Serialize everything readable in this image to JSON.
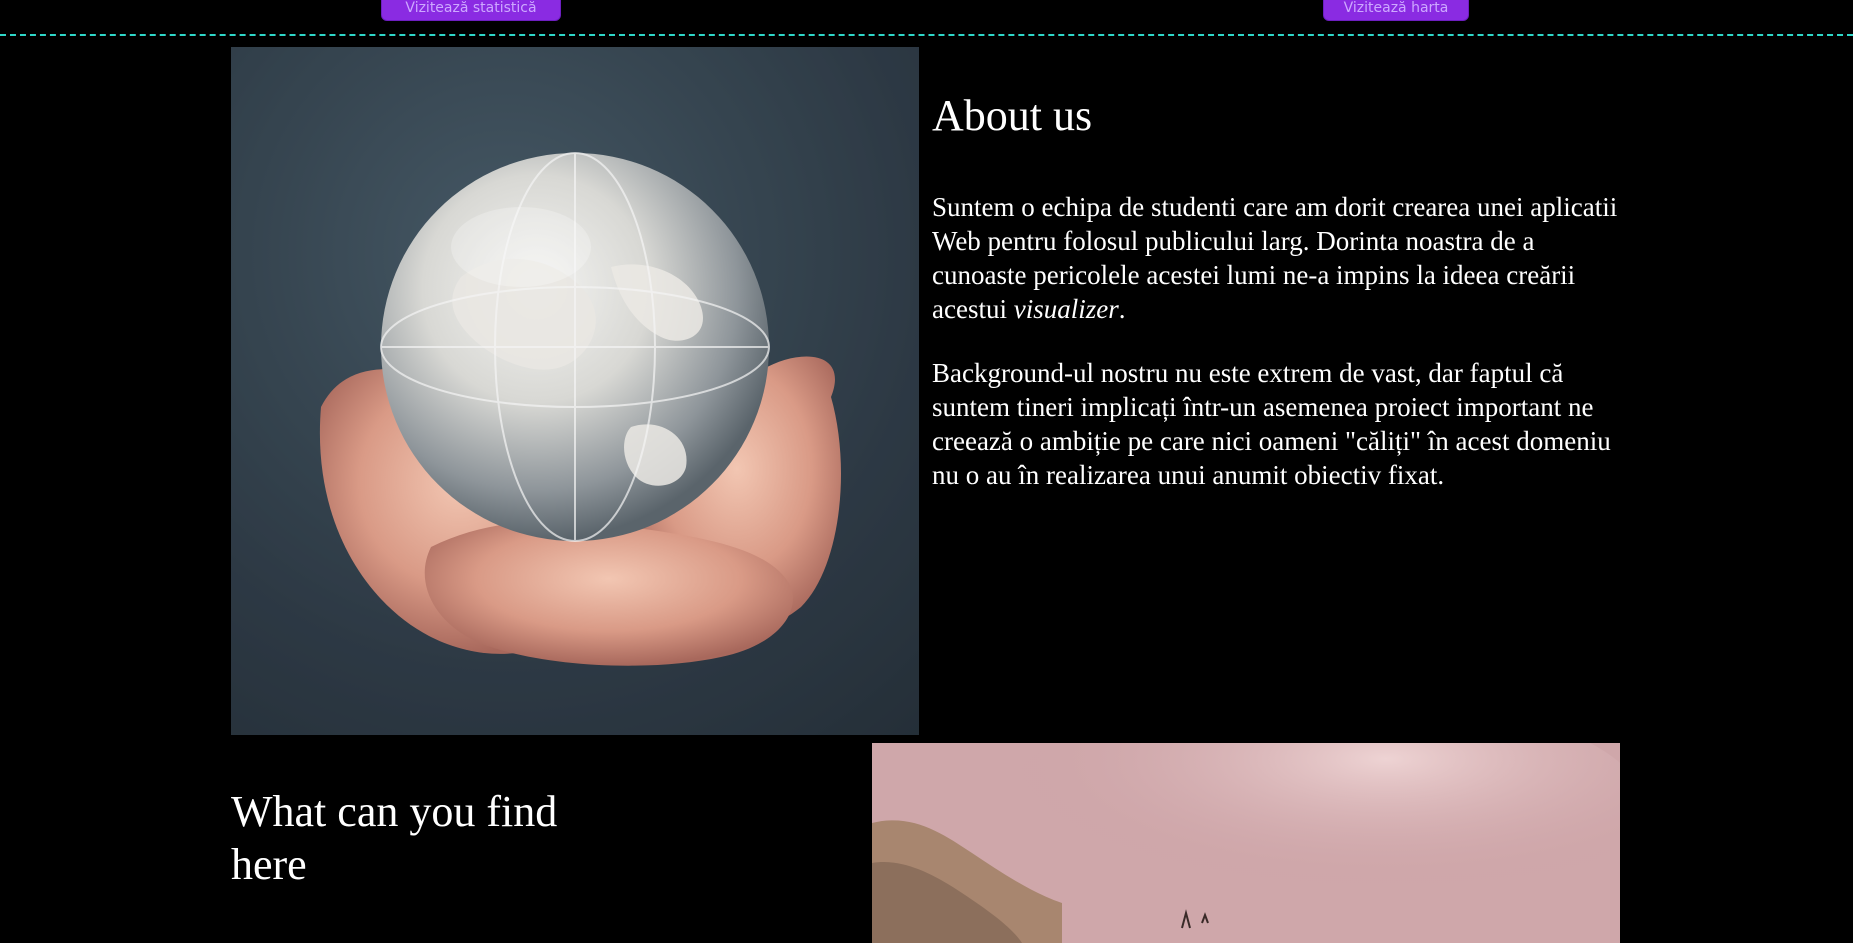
{
  "header": {
    "statistics_button": "Vizitează statistică",
    "map_button": "Vizitează harta"
  },
  "about": {
    "title": "About us",
    "paragraph1_before": "Suntem o echipa de studenti care am dorit crearea unei aplicatii Web pentru folosul publicului larg. Dorinta noastra de a cunoaste pericolele acestei lumi ne-a impins la ideea creării acestui ",
    "paragraph1_em": "visualizer",
    "paragraph1_after": ".",
    "paragraph2": "Background-ul nostru nu este extrem de vast, dar faptul că suntem tineri implicați într-un asemenea proiect important ne creează o ambiție pe care nici oameni \"căliți\" în acest domeniu nu o au în realizarea unui anumit obiectiv fixat."
  },
  "features": {
    "title": "What can you find here"
  },
  "images": {
    "globe": "globe-in-hands-photo",
    "fog": "pink-smoke-rocks-photo"
  },
  "colors": {
    "button": "#8a2be2",
    "divider": "#2fd6c8",
    "background": "#000000"
  }
}
